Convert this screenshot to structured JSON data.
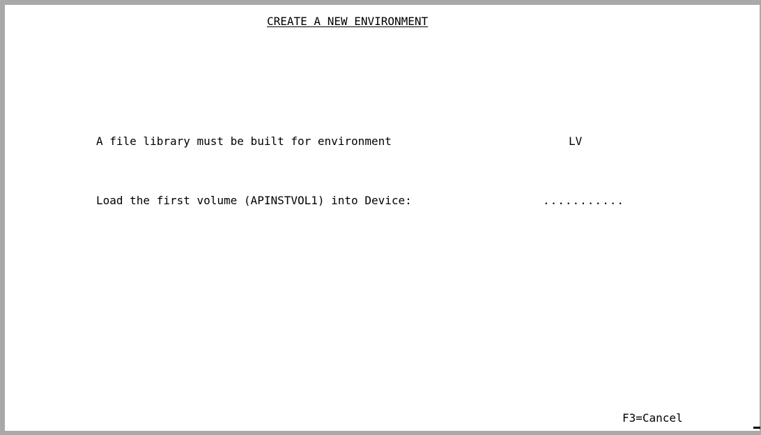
{
  "screen": {
    "title": "CREATE A NEW ENVIRONMENT",
    "message_label": "A file library must be built for environment",
    "environment_code": "LV",
    "load_prompt": "Load the first volume (APINSTVOL1) into Device:",
    "device_field_value": "...........",
    "function_key_cancel": "F3=Cancel"
  }
}
